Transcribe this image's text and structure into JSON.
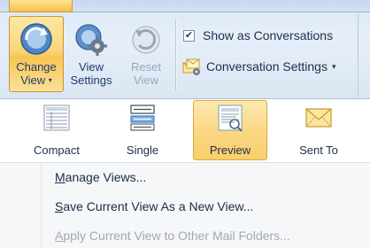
{
  "ribbon": {
    "change_view": {
      "line1": "Change",
      "line2": "View",
      "caret": "▾",
      "icon": "change-view-icon"
    },
    "view_settings": {
      "line1": "View",
      "line2": "Settings",
      "icon": "view-settings-gear-icon"
    },
    "reset_view": {
      "line1": "Reset",
      "line2": "View",
      "icon": "reset-view-icon"
    },
    "show_as_conversations": {
      "label": "Show as Conversations",
      "checked": true,
      "check_glyph": "✔"
    },
    "conversation_settings": {
      "label": "Conversation Settings",
      "caret": "▾",
      "icon": "conversation-settings-icon"
    }
  },
  "gallery": {
    "items": [
      {
        "label": "Compact",
        "icon": "compact-view-icon",
        "selected": false
      },
      {
        "label": "Single",
        "icon": "single-view-icon",
        "selected": false
      },
      {
        "label": "Preview",
        "icon": "preview-view-icon",
        "selected": true
      },
      {
        "label": "Sent To",
        "icon": "envelope-icon",
        "selected": false
      }
    ]
  },
  "menu": {
    "items": [
      {
        "accel": "M",
        "rest": "anage Views...",
        "enabled": true
      },
      {
        "accel": "S",
        "rest": "ave Current View As a New View...",
        "enabled": true
      },
      {
        "accel": "A",
        "rest": "pply Current View to Other Mail Folders...",
        "enabled": false
      }
    ]
  },
  "colors": {
    "accent_pressed": "#f9cf6c",
    "ribbon_bg": "#dce8f5",
    "menu_bg": "#f6f7f9",
    "text_disabled": "#a3a8b1"
  }
}
